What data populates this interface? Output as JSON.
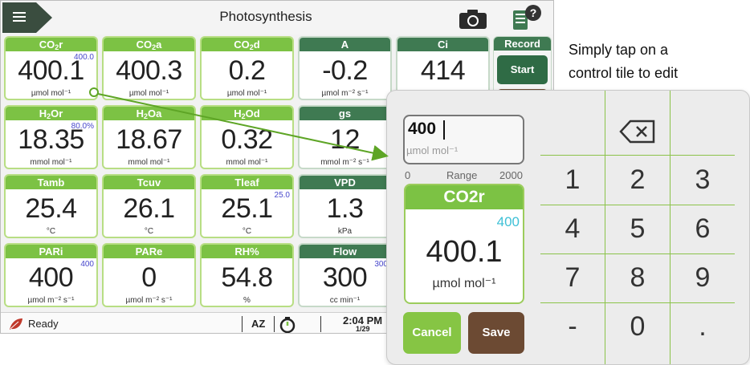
{
  "app": {
    "title": "Photosynthesis"
  },
  "icons": {
    "menu": "hamburger-menu-icon",
    "camera": "camera-icon",
    "help": "help-book-icon",
    "leaf": "leaf-icon",
    "timer": "stopwatch-icon",
    "backspace": "backspace-icon"
  },
  "colors": {
    "control_tile": "#7cc244",
    "measured_tile": "#3f7a52",
    "setpoint_text": "#4747cc",
    "save": "#6c4a33",
    "cancel": "#86c544",
    "arrow": "#5ea526"
  },
  "tiles": [
    {
      "name": "CO2r",
      "label_main": "CO",
      "label_sub": "2",
      "label_tail": "r",
      "value": "400.1",
      "unit": "µmol mol⁻¹",
      "setpoint": "400.0",
      "kind": "control"
    },
    {
      "name": "CO2a",
      "label_main": "CO",
      "label_sub": "2",
      "label_tail": "a",
      "value": "400.3",
      "unit": "µmol mol⁻¹",
      "setpoint": "",
      "kind": "control"
    },
    {
      "name": "CO2d",
      "label_main": "CO",
      "label_sub": "2",
      "label_tail": "d",
      "value": "0.2",
      "unit": "µmol mol⁻¹",
      "setpoint": "",
      "kind": "control"
    },
    {
      "name": "A",
      "label_main": "A",
      "label_sub": "",
      "label_tail": "",
      "value": "-0.2",
      "unit": "µmol m⁻² s⁻¹",
      "setpoint": "",
      "kind": "measured"
    },
    {
      "name": "Ci",
      "label_main": "Ci",
      "label_sub": "",
      "label_tail": "",
      "value": "414",
      "unit": "",
      "setpoint": "",
      "kind": "measured"
    },
    {
      "name": "H2Or",
      "label_main": "H",
      "label_sub": "2",
      "label_tail": "Or",
      "value": "18.35",
      "unit": "mmol mol⁻¹",
      "setpoint": "80.0%",
      "kind": "control"
    },
    {
      "name": "H2Oa",
      "label_main": "H",
      "label_sub": "2",
      "label_tail": "Oa",
      "value": "18.67",
      "unit": "mmol mol⁻¹",
      "setpoint": "",
      "kind": "control"
    },
    {
      "name": "H2Od",
      "label_main": "H",
      "label_sub": "2",
      "label_tail": "Od",
      "value": "0.32",
      "unit": "mmol mol⁻¹",
      "setpoint": "",
      "kind": "control"
    },
    {
      "name": "gs",
      "label_main": "gs",
      "label_sub": "",
      "label_tail": "",
      "value": "12",
      "unit": "mmol m⁻² s⁻¹",
      "setpoint": "",
      "kind": "measured"
    },
    {
      "name": "Tamb",
      "label_main": "Tamb",
      "label_sub": "",
      "label_tail": "",
      "value": "25.4",
      "unit": "°C",
      "setpoint": "",
      "kind": "control"
    },
    {
      "name": "Tcuv",
      "label_main": "Tcuv",
      "label_sub": "",
      "label_tail": "",
      "value": "26.1",
      "unit": "°C",
      "setpoint": "",
      "kind": "control"
    },
    {
      "name": "Tleaf",
      "label_main": "Tleaf",
      "label_sub": "",
      "label_tail": "",
      "value": "25.1",
      "unit": "°C",
      "setpoint": "25.0",
      "kind": "control"
    },
    {
      "name": "VPD",
      "label_main": "VPD",
      "label_sub": "",
      "label_tail": "",
      "value": "1.3",
      "unit": "kPa",
      "setpoint": "",
      "kind": "measured"
    },
    {
      "name": "PARi",
      "label_main": "PARi",
      "label_sub": "",
      "label_tail": "",
      "value": "400",
      "unit": "µmol m⁻² s⁻¹",
      "setpoint": "400",
      "kind": "control"
    },
    {
      "name": "PARe",
      "label_main": "PARe",
      "label_sub": "",
      "label_tail": "",
      "value": "0",
      "unit": "µmol m⁻² s⁻¹",
      "setpoint": "",
      "kind": "control"
    },
    {
      "name": "RH%",
      "label_main": "RH%",
      "label_sub": "",
      "label_tail": "",
      "value": "54.8",
      "unit": "%",
      "setpoint": "",
      "kind": "control"
    },
    {
      "name": "Flow",
      "label_main": "Flow",
      "label_sub": "",
      "label_tail": "",
      "value": "300",
      "unit": "cc min⁻¹",
      "setpoint": "300",
      "kind": "measured"
    }
  ],
  "record": {
    "header": "Record",
    "start_label": "Start"
  },
  "status": {
    "text": "Ready",
    "az": "AZ",
    "time": "2:04 PM",
    "date": "1/29"
  },
  "callout": {
    "line1": "Simply tap on a",
    "line2": "control tile to edit"
  },
  "dialog": {
    "entry_value": "400",
    "entry_unit": "µmol mol⁻¹",
    "range_min": "0",
    "range_label": "Range",
    "range_max": "2000",
    "preview": {
      "title": "CO2r",
      "setpoint": "400",
      "value": "400.1",
      "unit": "µmol mol⁻¹"
    },
    "cancel_label": "Cancel",
    "save_label": "Save",
    "keys": [
      "1",
      "2",
      "3",
      "4",
      "5",
      "6",
      "7",
      "8",
      "9",
      "-",
      "0",
      "."
    ]
  }
}
